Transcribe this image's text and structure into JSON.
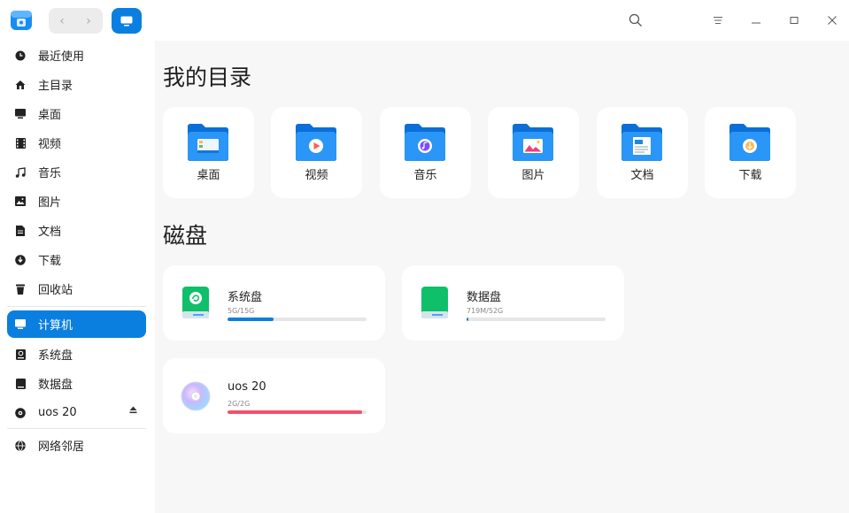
{
  "titlebar": {
    "back_label": "‹",
    "forward_label": "›"
  },
  "sidebar": {
    "items": [
      {
        "label": "最近使用",
        "icon": "clock-icon"
      },
      {
        "label": "主目录",
        "icon": "home-icon"
      },
      {
        "label": "桌面",
        "icon": "desktop-icon"
      },
      {
        "label": "视频",
        "icon": "video-icon"
      },
      {
        "label": "音乐",
        "icon": "music-icon"
      },
      {
        "label": "图片",
        "icon": "image-icon"
      },
      {
        "label": "文档",
        "icon": "document-icon"
      },
      {
        "label": "下载",
        "icon": "download-icon"
      },
      {
        "label": "回收站",
        "icon": "trash-icon"
      },
      {
        "label": "计算机",
        "icon": "computer-icon",
        "active": true
      },
      {
        "label": "系统盘",
        "icon": "system-disk-icon"
      },
      {
        "label": "数据盘",
        "icon": "data-disk-icon"
      },
      {
        "label": "uos 20",
        "icon": "optical-disc-icon"
      },
      {
        "label": "网络邻居",
        "icon": "network-icon"
      }
    ]
  },
  "main": {
    "my_directory_title": "我的目录",
    "folders": [
      {
        "label": "桌面",
        "icon": "desktop-folder-icon"
      },
      {
        "label": "视频",
        "icon": "video-folder-icon"
      },
      {
        "label": "音乐",
        "icon": "music-folder-icon"
      },
      {
        "label": "图片",
        "icon": "pictures-folder-icon"
      },
      {
        "label": "文档",
        "icon": "documents-folder-icon"
      },
      {
        "label": "下载",
        "icon": "downloads-folder-icon"
      }
    ],
    "disks_title": "磁盘",
    "disks": [
      {
        "name": "系统盘",
        "size": "5G/15G",
        "usage": 0.33,
        "color": "#0a7fe0"
      },
      {
        "name": "数据盘",
        "size": "719M/52G",
        "usage": 0.014,
        "color": "#0a7fe0"
      },
      {
        "name": "uos 20",
        "size": "2G/2G",
        "usage": 0.97,
        "color": "#f2506b"
      }
    ]
  },
  "colors": {
    "accent": "#0a7fe0",
    "full_disk": "#f2506b",
    "folder_blue": "#1e90f5"
  }
}
